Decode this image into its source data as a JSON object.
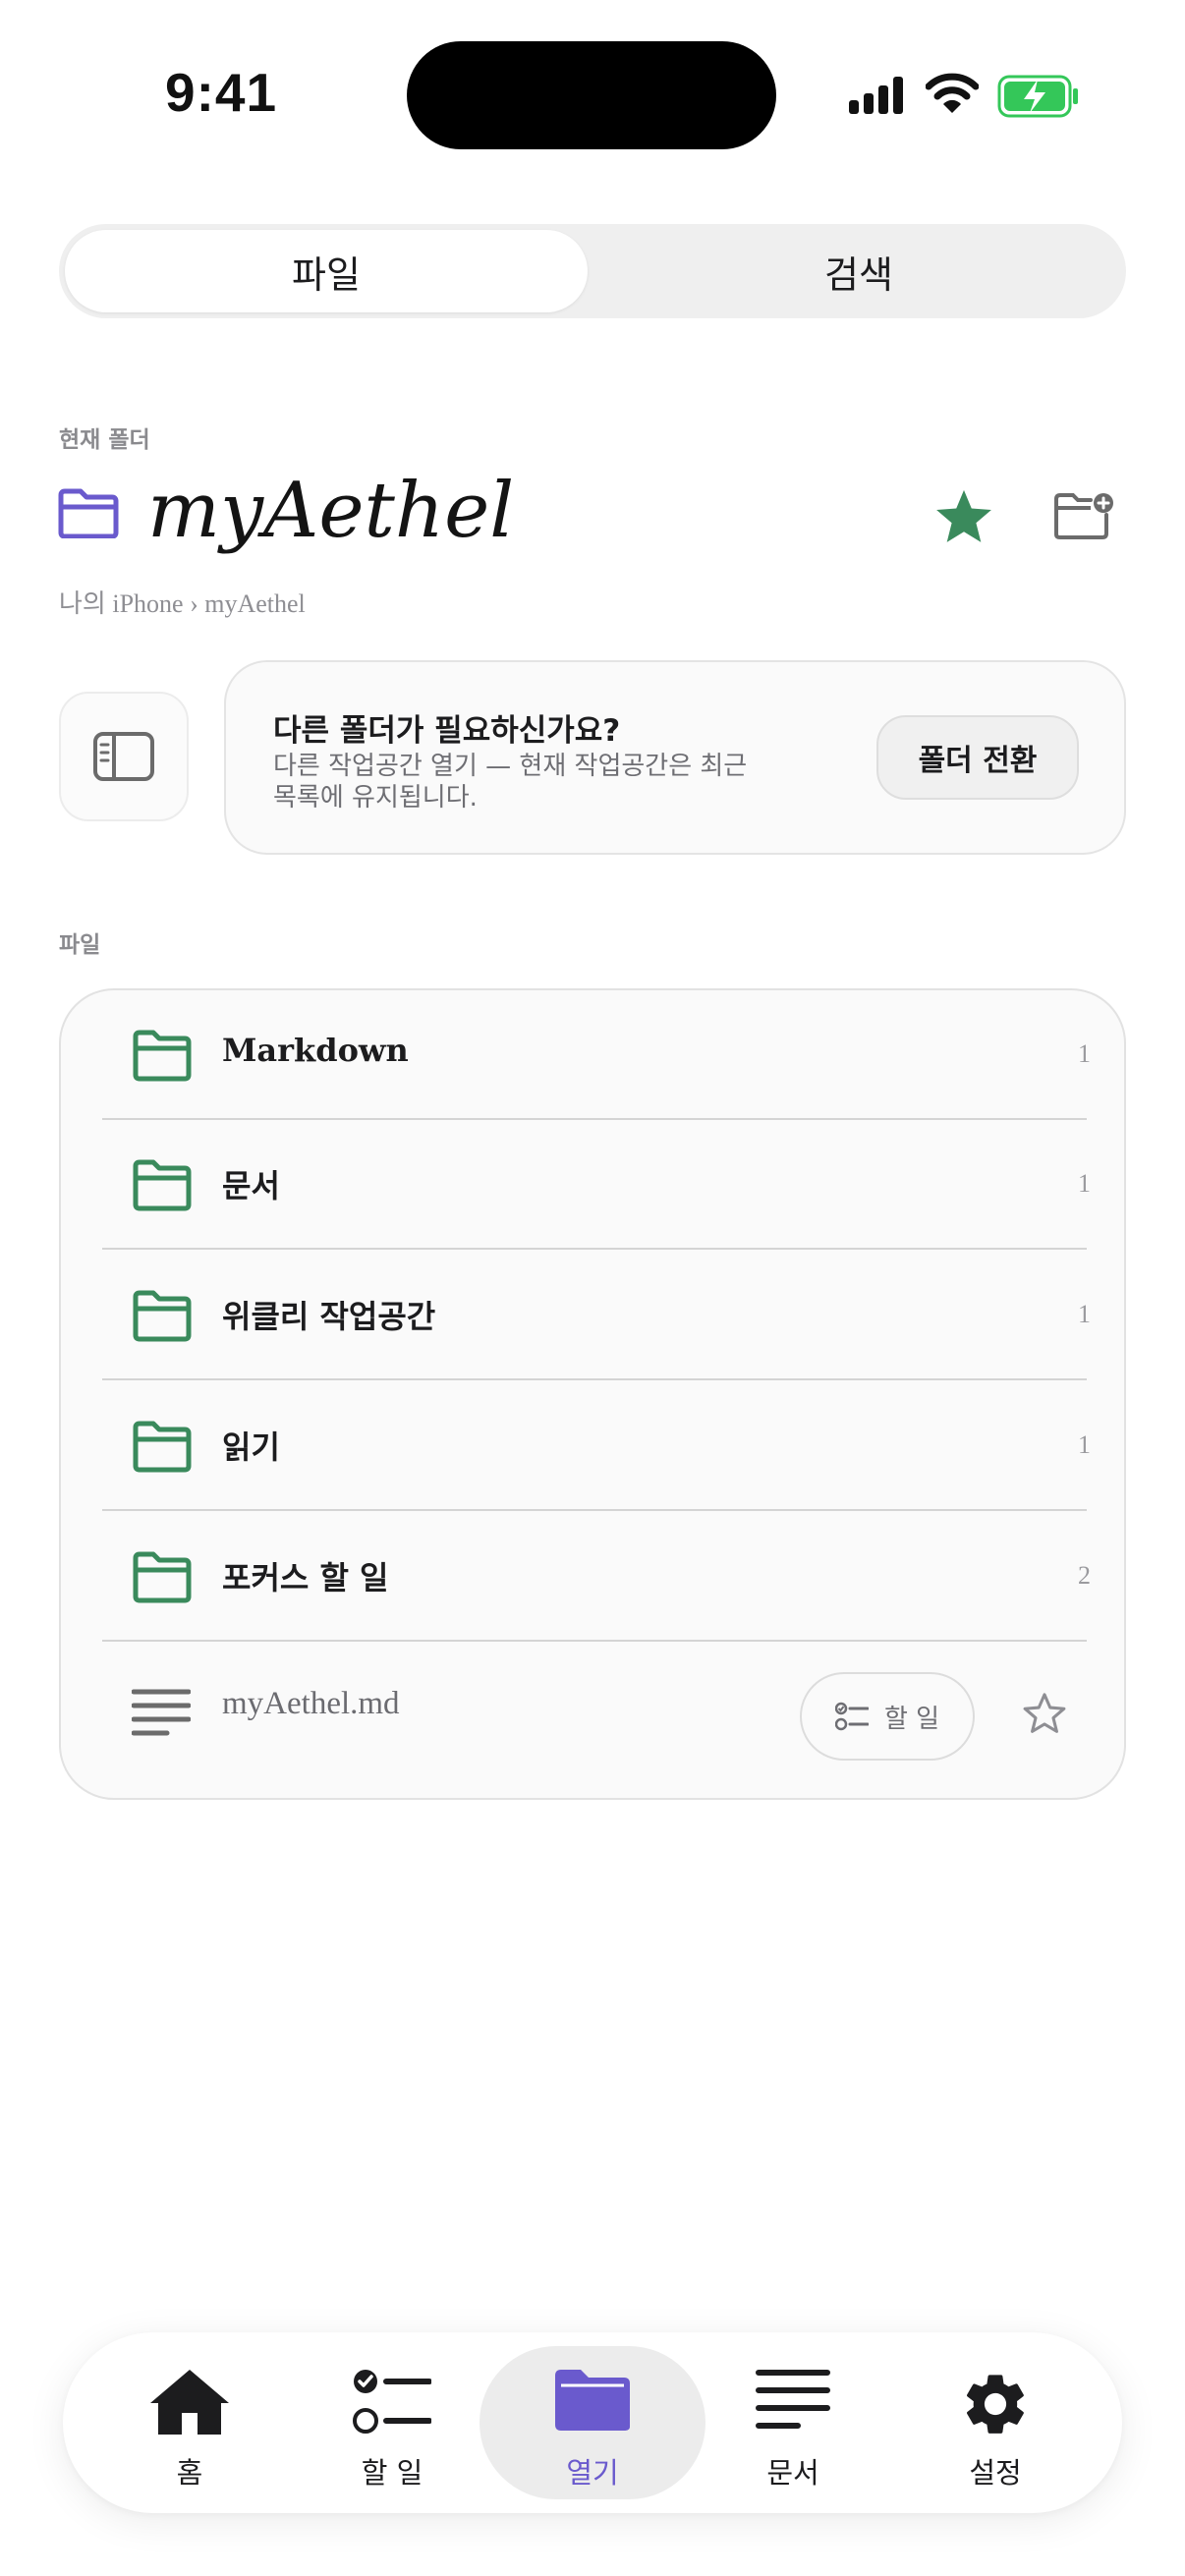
{
  "status": {
    "time": "9:41"
  },
  "segment": {
    "files": "파일",
    "search": "검색",
    "selected": "파일"
  },
  "current_folder": {
    "section_label": "현재 폴더",
    "title": "myAethel",
    "breadcrumb": "나의 iPhone › myAethel",
    "favorited": true
  },
  "switch_card": {
    "title": "다른 폴더가 필요하신가요?",
    "description": "다른 작업공간 열기 — 현재 작업공간은 최근 목록에 유지됩니다.",
    "button": "폴더 전환"
  },
  "files": {
    "section_label": "파일",
    "folders": [
      {
        "name": "Markdown",
        "count": "1"
      },
      {
        "name": "문서",
        "count": "1"
      },
      {
        "name": "위클리 작업공간",
        "count": "1"
      },
      {
        "name": "읽기",
        "count": "1"
      },
      {
        "name": "포커스 할 일",
        "count": "2"
      }
    ],
    "document": {
      "name": "myAethel.md",
      "todo_label": "할 일"
    }
  },
  "tabbar": {
    "tabs": [
      {
        "label": "홈",
        "icon": "home-icon"
      },
      {
        "label": "할 일",
        "icon": "checklist-icon"
      },
      {
        "label": "열기",
        "icon": "folder-icon"
      },
      {
        "label": "문서",
        "icon": "document-lines-icon"
      },
      {
        "label": "설정",
        "icon": "gear-icon"
      }
    ],
    "active": "열기"
  },
  "colors": {
    "accent_purple": "#6a5acd",
    "folder_green": "#3a8a5c",
    "star_green": "#3a8a5c",
    "battery_green": "#34c759"
  }
}
